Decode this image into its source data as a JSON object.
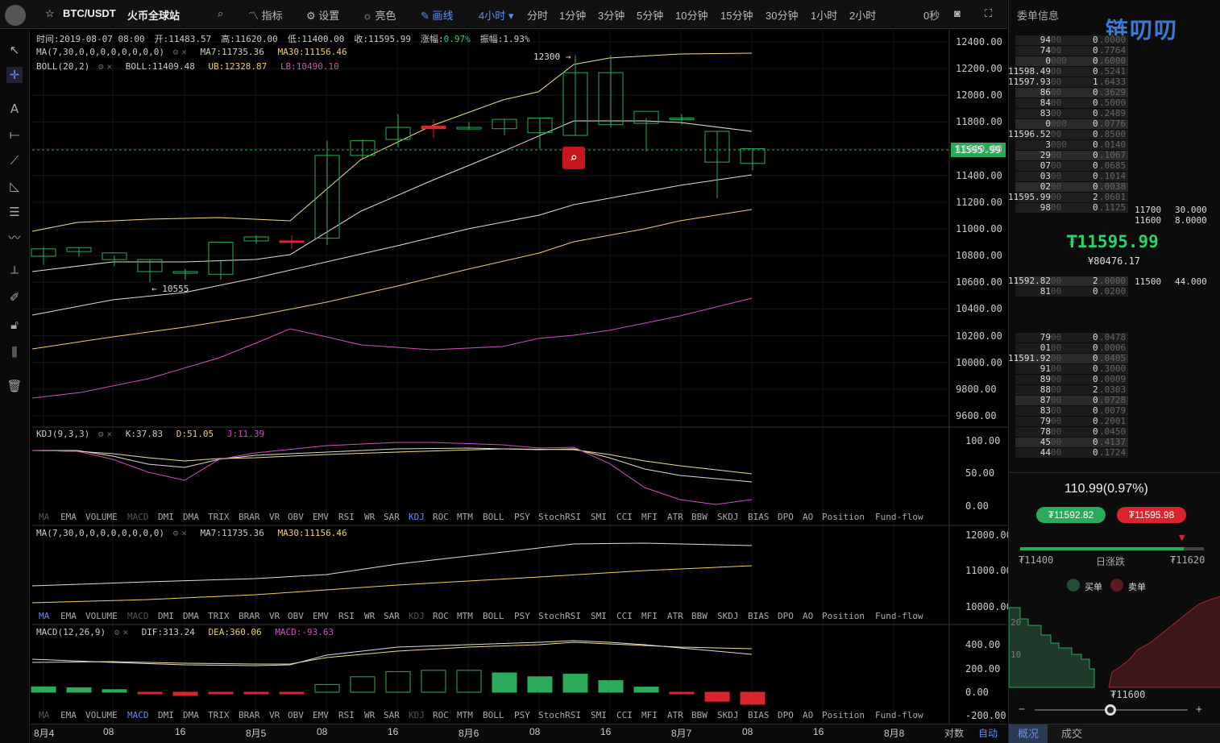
{
  "toolbar": {
    "symbol": "BTC/USDT",
    "exchange": "火币全球站",
    "indicators": "指标",
    "settings": "设置",
    "theme": "亮色",
    "draw": "画线",
    "period": "4小时",
    "timeframes": [
      "分时",
      "1分钟",
      "3分钟",
      "5分钟",
      "10分钟",
      "15分钟",
      "30分钟",
      "1小时",
      "2小时"
    ],
    "countdown": "0秒"
  },
  "main_info": {
    "line1": [
      {
        "t": "时间:2019-08-07 08:00",
        "c": "#ccc"
      },
      {
        "t": "开:11483.57",
        "c": "#ccc"
      },
      {
        "t": "高:11620.00",
        "c": "#ccc"
      },
      {
        "t": "低:11400.00",
        "c": "#ccc"
      },
      {
        "t": "收:11595.99",
        "c": "#ccc"
      },
      {
        "t": "涨幅:",
        "c": "#ccc"
      },
      {
        "t": "0.97%",
        "c": "#2bd36b"
      },
      {
        "t": "振幅:1.93%",
        "c": "#ccc"
      }
    ],
    "ma_name": "MA(7,30,0,0,0,0,0,0,0,0)",
    "ma7": "MA7:11735.36",
    "ma30": "MA30:11156.46",
    "boll_name": "BOLL(20,2)",
    "boll": "BOLL:11409.48",
    "ub": "UB:12328.87",
    "lb": "LB:10490.10",
    "hi_mark": "12300",
    "lo_mark": "10555"
  },
  "price_axis": [
    "12400.00",
    "12200.00",
    "12000.00",
    "11800.00",
    "11600.00",
    "11400.00",
    "11200.00",
    "11000.00",
    "10800.00",
    "10600.00",
    "10400.00",
    "10200.00",
    "10000.00",
    "9800.00",
    "9600.00"
  ],
  "current_price": "11595.99",
  "kdj": {
    "name": "KDJ(9,3,3)",
    "k": "K:37.83",
    "d": "D:51.05",
    "j": "J:11.39",
    "axis": [
      "100.00",
      "50.00",
      "0.00"
    ]
  },
  "ma_panel": {
    "name": "MA(7,30,0,0,0,0,0,0,0,0)",
    "ma7": "MA7:11735.36",
    "ma30": "MA30:11156.46",
    "axis": [
      "12000.00",
      "11000.00",
      "10000.00"
    ]
  },
  "macd": {
    "name": "MACD(12,26,9)",
    "dif": "DIF:313.24",
    "dea": "DEA:360.06",
    "macd": "MACD:-93.63",
    "axis": [
      "400.00",
      "200.00",
      "0.00",
      "-200.00"
    ]
  },
  "indicator_tabs": [
    "MA",
    "EMA",
    "VOLUME",
    "MACD",
    "DMI",
    "DMA",
    "TRIX",
    "BRAR",
    "VR",
    "OBV",
    "EMV",
    "RSI",
    "WR",
    "SAR",
    "KDJ",
    "ROC",
    "MTM",
    "BOLL",
    "PSY",
    "StochRSI",
    "SMI",
    "CCI",
    "MFI",
    "ATR",
    "BBW",
    "SKDJ",
    "BIAS",
    "DPO",
    "AO",
    "Position",
    "Fund-flow"
  ],
  "time_axis": [
    "8月4",
    "08",
    "16",
    "8月5",
    "08",
    "16",
    "8月6",
    "08",
    "16",
    "8月7",
    "08",
    "16",
    "8月8"
  ],
  "bottom": {
    "log": "对数",
    "auto": "自动"
  },
  "right": {
    "title": "委单信息",
    "brand": "链叨叨",
    "last_price": "₮11595.99",
    "cny": "¥80476.17",
    "asks": [
      [
        "94",
        "00",
        "0",
        "0000"
      ],
      [
        "74",
        "00",
        "0",
        "7764"
      ],
      [
        "0",
        "000",
        "0",
        "6000"
      ],
      [
        "11598.49",
        "00",
        "0",
        "5241"
      ],
      [
        "11597.93",
        "00",
        "1",
        "6433"
      ],
      [
        "86",
        "00",
        "0",
        "3629"
      ],
      [
        "84",
        "00",
        "0",
        "5000"
      ],
      [
        "83",
        "00",
        "0",
        "2489"
      ],
      [
        "0",
        "000",
        "0",
        "0776"
      ],
      [
        "11596.52",
        "00",
        "0",
        "8500"
      ],
      [
        "3",
        "000",
        "0",
        "0140"
      ],
      [
        "29",
        "00",
        "0",
        "1067"
      ],
      [
        "07",
        "00",
        "0",
        "0685"
      ],
      [
        "03",
        "00",
        "0",
        "1014"
      ],
      [
        "02",
        "00",
        "0",
        "0038"
      ],
      [
        "11595.99",
        "00",
        "2",
        "0601"
      ],
      [
        "98",
        "00",
        "0",
        "1125"
      ]
    ],
    "bids": [
      [
        "11592.82",
        "00",
        "2",
        "0000"
      ],
      [
        "81",
        "00",
        "0",
        "0200"
      ],
      [
        "79",
        "00",
        "0",
        "0478"
      ],
      [
        "01",
        "00",
        "0",
        "0006"
      ],
      [
        "11591.92",
        "00",
        "0",
        "0405"
      ],
      [
        "91",
        "00",
        "0",
        "3000"
      ],
      [
        "89",
        "00",
        "0",
        "0009"
      ],
      [
        "88",
        "00",
        "2",
        "0303"
      ],
      [
        "87",
        "00",
        "0",
        "0728"
      ],
      [
        "83",
        "00",
        "0",
        "0079"
      ],
      [
        "79",
        "00",
        "0",
        "2001"
      ],
      [
        "78",
        "00",
        "0",
        "0450"
      ],
      [
        "45",
        "00",
        "0",
        "4137"
      ],
      [
        "44",
        "00",
        "0",
        "1724"
      ]
    ],
    "big_orders": [
      [
        "11700",
        "30.000"
      ],
      [
        "11600",
        "8.0000"
      ],
      [
        "11500",
        "44.000"
      ]
    ],
    "change": "110.99(0.97%)",
    "bid_btn": "₮11592.82",
    "ask_btn": "₮11595.98",
    "range_low": "₮11400",
    "range_label": "日涨跌",
    "range_high": "₮11620",
    "range_pos": 0.89,
    "buy_label": "买单",
    "sell_label": "卖单",
    "depth_y": [
      "20",
      "10"
    ],
    "depth_x": "₮11600",
    "tab_overview": "概况",
    "tab_trades": "成交",
    "zoom_minus": "−",
    "zoom_plus": "+"
  },
  "chart_data": {
    "type": "candlestick",
    "interval": "4小时",
    "ohlc": [
      [
        10795,
        10865,
        10730,
        10850
      ],
      [
        10830,
        10860,
        10790,
        10860
      ],
      [
        10770,
        10800,
        10720,
        10820
      ],
      [
        10680,
        10770,
        10600,
        10770
      ],
      [
        10670,
        10700,
        10620,
        10680
      ],
      [
        10660,
        10760,
        10620,
        10900
      ],
      [
        10910,
        10950,
        10890,
        10940
      ],
      [
        10910,
        10950,
        10850,
        10900
      ],
      [
        10930,
        11660,
        10880,
        11550
      ],
      [
        11550,
        11670,
        11530,
        11660
      ],
      [
        11670,
        11860,
        11610,
        11760
      ],
      [
        11770,
        11820,
        11680,
        11750
      ],
      [
        11750,
        11800,
        11740,
        11760
      ],
      [
        11750,
        11820,
        11700,
        11820
      ],
      [
        11720,
        11830,
        11600,
        11830
      ],
      [
        11700,
        12300,
        11700,
        12170
      ],
      [
        11780,
        12300,
        11760,
        12170
      ],
      [
        11790,
        11830,
        11580,
        11880
      ],
      [
        11820,
        11860,
        11780,
        11830
      ],
      [
        11500,
        11730,
        11230,
        11730
      ],
      [
        11490,
        11600,
        11440,
        11600
      ]
    ],
    "boll_ub": [
      12330
    ],
    "boll_mid": [
      11410
    ],
    "boll_lb": [
      10490
    ],
    "ma7_last": 11735.36,
    "ma30_last": 11156.46,
    "kdj_last": {
      "k": 37.83,
      "d": 51.05,
      "j": 11.39
    },
    "macd_hist": [
      42,
      35,
      20,
      -8,
      -25,
      -10,
      -5,
      -5,
      60,
      120,
      160,
      170,
      170,
      150,
      120,
      140,
      90,
      40,
      -10,
      -70,
      -93.63
    ],
    "dif_last": 313.24,
    "dea_last": 360.06
  }
}
